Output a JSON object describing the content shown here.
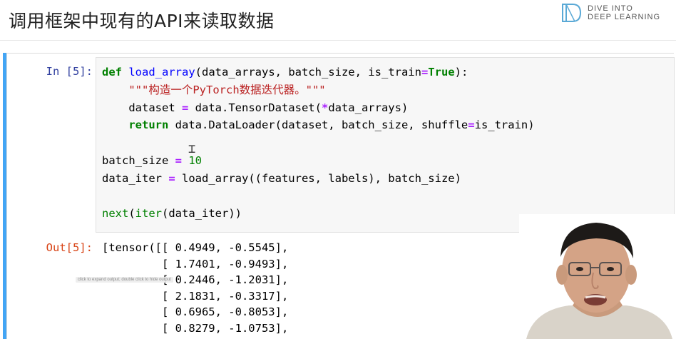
{
  "slide": {
    "title": "调用框架中现有的API来读取数据",
    "logo_line1": "DIVE INTO",
    "logo_line2": "DEEP LEARNING"
  },
  "cell": {
    "in_prompt": "In [5]:",
    "out_prompt": "Out[5]:",
    "code_lines": [
      [
        "def",
        " ",
        "load_array",
        "(data_arrays, batch_size, is_train",
        "=",
        "True",
        "):"
      ],
      [
        "    ",
        "\"\"\"构造一个PyTorch数据迭代器。\"\"\""
      ],
      [
        "    dataset ",
        "=",
        " data.TensorDataset(",
        "*",
        "data_arrays)"
      ],
      [
        "    ",
        "return",
        " data.DataLoader(dataset, batch_size, shuffle",
        "=",
        "is_train)"
      ],
      [
        ""
      ],
      [
        "batch_size ",
        "=",
        " ",
        "10"
      ],
      [
        "data_iter ",
        "=",
        " load_array((features, labels), batch_size)"
      ],
      [
        ""
      ],
      [
        "next",
        "(",
        "iter",
        "(data_iter))"
      ]
    ],
    "output_lines": [
      "[tensor([[ 0.4949, -0.5545],",
      "         [ 1.7401, -0.9493],",
      "         [-0.2446, -1.2031],",
      "         [ 2.1831, -0.3317],",
      "         [ 0.6965, -0.8053],",
      "         [ 0.8279, -1.0753],"
    ],
    "output_tooltip": "click to expand output; double click to hide output"
  },
  "colors": {
    "cell_bar": "#42a5f5",
    "in_prompt": "#303f9f",
    "out_prompt": "#d84315",
    "keyword": "#008000",
    "string": "#ba2121",
    "operator": "#aa22ff",
    "function_name": "#0000ff"
  },
  "icons": {
    "logo": "d2l-book-logo",
    "cursor": "text-cursor-icon"
  }
}
